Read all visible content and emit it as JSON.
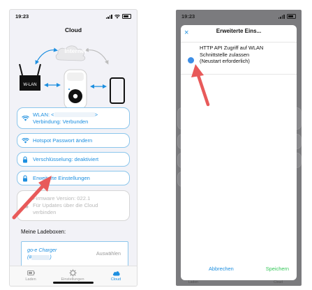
{
  "left": {
    "status_time": "19:23",
    "nav_title": "Cloud",
    "diagram": {
      "cloud_label": "Internet",
      "router_label": "W-LAN"
    },
    "buttons": [
      {
        "line1": "WLAN: <",
        "line1_end": ">",
        "line2": "Verbindung: Verbunden"
      },
      {
        "line1": "Hotspot Passwort ändern"
      },
      {
        "line1": "Verschlüsselung: deaktiviert"
      },
      {
        "line1": "Erweiterte Einstellungen"
      },
      {
        "line1": "Firmware Version: 022.1",
        "line2": "Für Updates über die Cloud",
        "line3": "verbinden"
      }
    ],
    "section_title": "Meine Ladeboxen:",
    "charger": {
      "name": "go-e Charger",
      "id_prefix": "(#",
      "id_suffix": ")",
      "select": "Auswählen"
    },
    "tabs": [
      "Laden",
      "Einstellungen",
      "Cloud"
    ],
    "colors": {
      "accent": "#1d8fe0",
      "arrow": "#e85a5a"
    }
  },
  "right": {
    "status_time": "19:23",
    "modal_title": "Erweiterte Eins...",
    "close_symbol": "×",
    "option": {
      "line1": "HTTP API Zugriff auf WLAN",
      "line2": "Schnittstelle zulassen",
      "line3": "(Neustart erforderlich)"
    },
    "cancel": "Abbrechen",
    "save": "Speichern",
    "tabs": [
      "Laden",
      "Cloud"
    ],
    "colors": {
      "toggle": "#3d8ee6",
      "save": "#34c759"
    }
  }
}
